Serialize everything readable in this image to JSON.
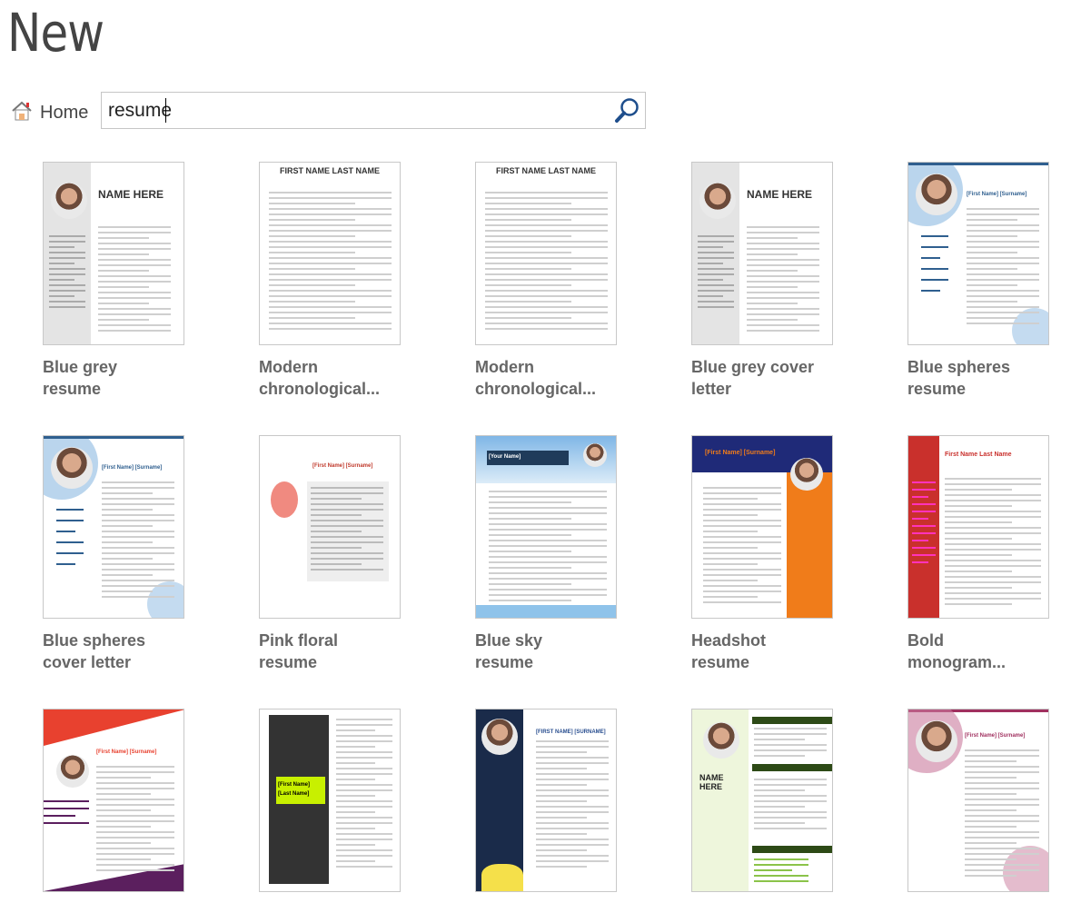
{
  "page": {
    "title": "New"
  },
  "nav": {
    "home_label": "Home",
    "home_icon": "home-icon"
  },
  "search": {
    "value": "resume",
    "icon": "search-icon",
    "icon_color": "#1e4e8c"
  },
  "templates": [
    {
      "label1": "Blue grey",
      "label2": "resume",
      "heading": "NAME HERE",
      "layout": "sidebar",
      "accent": "#2e75b6",
      "side": "#e4e4e4",
      "photo": true
    },
    {
      "label1": "Modern",
      "label2": "chronological...",
      "heading": "FIRST NAME LAST NAME",
      "layout": "plain",
      "accent": "#2e8b8b",
      "side": "#ffffff",
      "photo": false
    },
    {
      "label1": "Modern",
      "label2": "chronological...",
      "heading": "FIRST NAME LAST NAME",
      "layout": "plain",
      "accent": "#2e8b8b",
      "side": "#ffffff",
      "photo": false
    },
    {
      "label1": "Blue grey cover",
      "label2": "letter",
      "heading": "NAME HERE",
      "layout": "sidebar",
      "accent": "#2e75b6",
      "side": "#e4e4e4",
      "photo": true
    },
    {
      "label1": "Blue spheres",
      "label2": "resume",
      "heading": "[First Name] [Surname]",
      "layout": "spheres",
      "accent": "#2f5f8f",
      "side": "#9cc3e6",
      "photo": true
    },
    {
      "label1": "Blue spheres",
      "label2": "cover letter",
      "heading": "[First Name] [Surname]",
      "layout": "spheres",
      "accent": "#2f5f8f",
      "side": "#9cc3e6",
      "photo": true
    },
    {
      "label1": "Pink floral",
      "label2": "resume",
      "heading": "[First Name] [Surname]",
      "layout": "floral",
      "accent": "#c0392b",
      "side": "#eeeeee",
      "photo": false
    },
    {
      "label1": "Blue sky",
      "label2": "resume",
      "heading": "[Your Name]",
      "layout": "sky",
      "accent": "#1f3b5a",
      "side": "#8fc3ea",
      "photo": true
    },
    {
      "label1": "Headshot",
      "label2": "resume",
      "heading": "[First Name] [Surname]",
      "layout": "headshot",
      "accent": "#f07c1a",
      "side": "#1f2a78",
      "photo": true
    },
    {
      "label1": "Bold",
      "label2": "monogram...",
      "heading": "First Name Last Name",
      "layout": "monogram",
      "accent": "#c9302c",
      "side": "#c9302c",
      "photo": false
    },
    {
      "label1": "",
      "label2": "",
      "heading": "[First Name] [Surname]",
      "layout": "geo",
      "accent": "#e8412f",
      "side": "#5b1f5e",
      "photo": true
    },
    {
      "label1": "",
      "label2": "",
      "heading": "[First Name] [Last Name]",
      "layout": "lime",
      "accent": "#c8f000",
      "side": "#d8f000",
      "photo": true
    },
    {
      "label1": "",
      "label2": "",
      "heading": "[FIRST NAME] [SURNAME]",
      "layout": "navy",
      "accent": "#1a2b4a",
      "side": "#1a2b4a",
      "photo": true
    },
    {
      "label1": "",
      "label2": "",
      "heading": "NAME HERE",
      "layout": "green",
      "accent": "#2d4a16",
      "side": "#eef6dc",
      "photo": true
    },
    {
      "label1": "",
      "label2": "",
      "heading": "[First Name] [Surname]",
      "layout": "berry",
      "accent": "#a0305f",
      "side": "#c97a9c",
      "photo": true
    }
  ]
}
